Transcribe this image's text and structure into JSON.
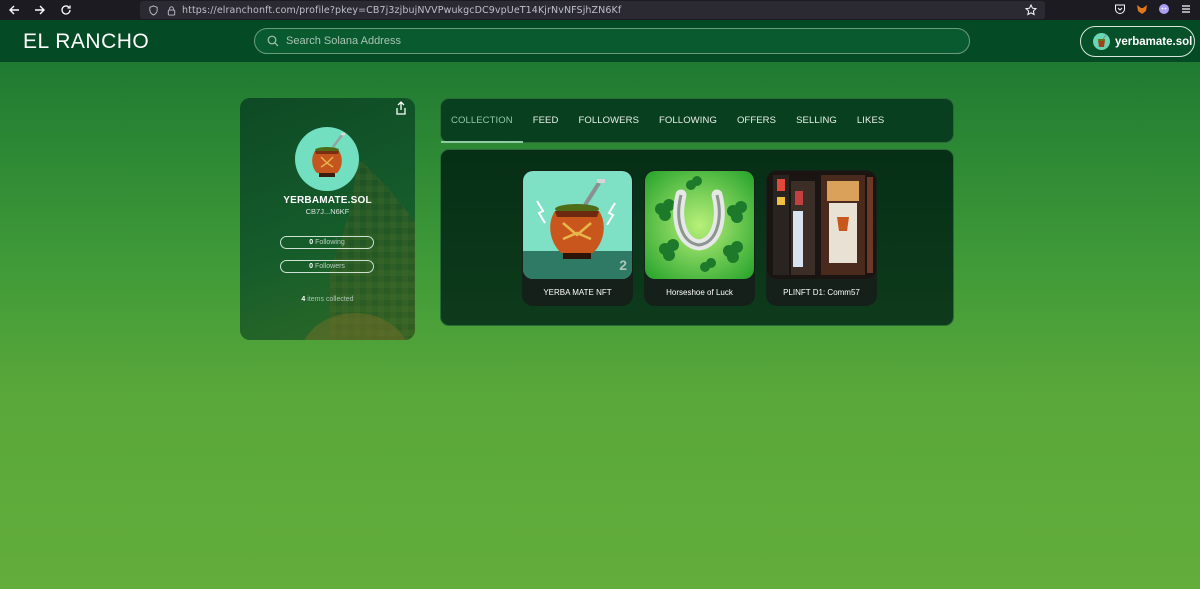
{
  "browser": {
    "url": "https://elranchonft.com/profile?pkey=CB7j3zjbujNVVPwukgcDC9vpUeT14KjrNvNFSjhZN6Kf"
  },
  "header": {
    "brand": "EL RANCHO",
    "search_placeholder": "Search Solana Address",
    "wallet_label": "yerbamate.sol"
  },
  "profile": {
    "name": "YERBAMATE.SOL",
    "address_short": "CB7J...N6KF",
    "following_count": "0",
    "following_label": "Following",
    "followers_count": "0",
    "followers_label": "Followers",
    "items_count": "4",
    "items_label": "items collected"
  },
  "tabs": [
    {
      "label": "COLLECTION",
      "active": true
    },
    {
      "label": "FEED"
    },
    {
      "label": "FOLLOWERS"
    },
    {
      "label": "FOLLOWING"
    },
    {
      "label": "OFFERS"
    },
    {
      "label": "SELLING"
    },
    {
      "label": "LIKES"
    }
  ],
  "collection": [
    {
      "title": "YERBA MATE NFT",
      "badge": "2"
    },
    {
      "title": "Horseshoe of Luck"
    },
    {
      "title": "PLINFT D1: Comm57"
    }
  ],
  "colors": {
    "header_bg": "#044a25",
    "accent_tab": "#8fc9a5",
    "avatar_bg": "#72dfc0"
  }
}
